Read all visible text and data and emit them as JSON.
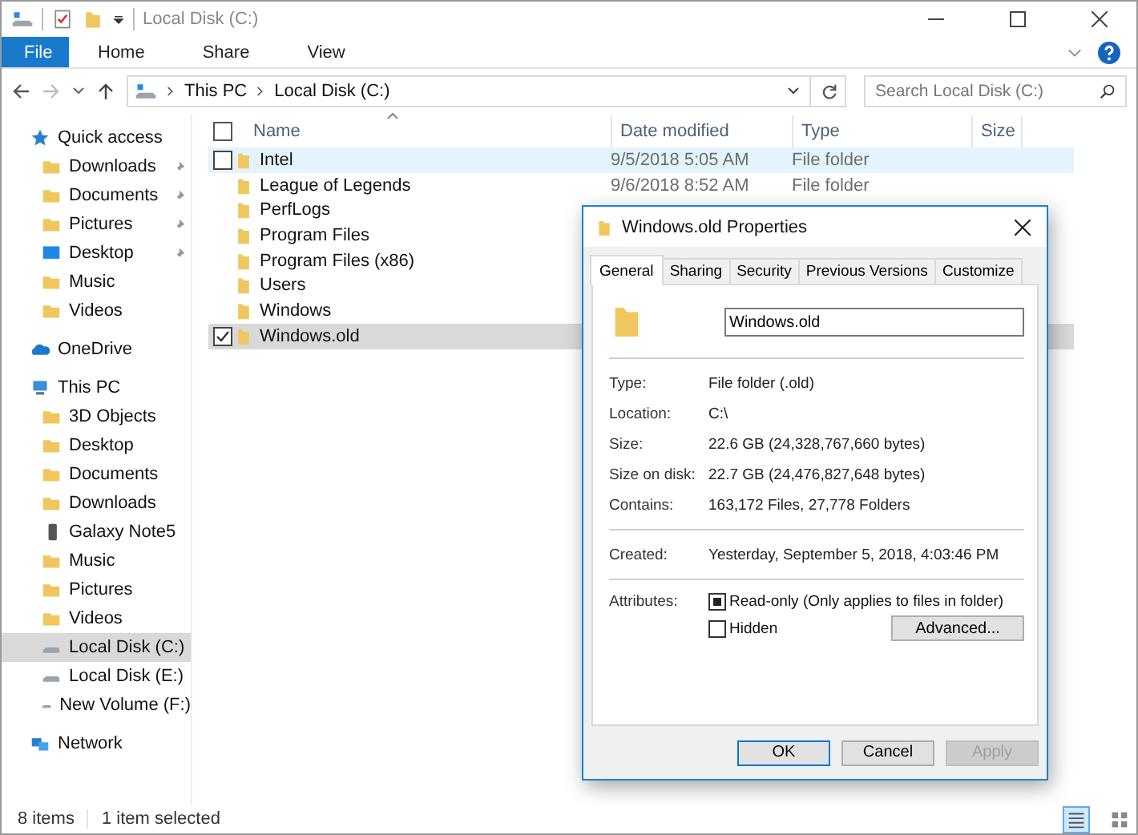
{
  "window": {
    "title": "Local Disk (C:)"
  },
  "ribbon_tabs": [
    {
      "label": "File",
      "selected": true
    },
    {
      "label": "Home",
      "selected": false
    },
    {
      "label": "Share",
      "selected": false
    },
    {
      "label": "View",
      "selected": false
    }
  ],
  "address": {
    "crumbs": [
      "This PC",
      "Local Disk (C:)"
    ]
  },
  "search": {
    "placeholder": "Search Local Disk (C:)"
  },
  "sidebar": {
    "items": [
      {
        "label": "Quick access",
        "kind": "star",
        "selected": false,
        "children": [
          {
            "label": "Downloads",
            "kind": "folder",
            "pinned": true,
            "selected": false
          },
          {
            "label": "Documents",
            "kind": "folder",
            "pinned": true,
            "selected": false
          },
          {
            "label": "Pictures",
            "kind": "folder",
            "pinned": true,
            "selected": false
          },
          {
            "label": "Desktop",
            "kind": "desktop",
            "pinned": true,
            "selected": false
          },
          {
            "label": "Music",
            "kind": "folder",
            "pinned": false,
            "selected": false
          },
          {
            "label": "Videos",
            "kind": "folder",
            "pinned": false,
            "selected": false
          }
        ]
      },
      {
        "label": "OneDrive",
        "kind": "cloud",
        "selected": false
      },
      {
        "label": "This PC",
        "kind": "pc",
        "selected": false,
        "children": [
          {
            "label": "3D Objects",
            "kind": "folder",
            "selected": false
          },
          {
            "label": "Desktop",
            "kind": "folder",
            "selected": false
          },
          {
            "label": "Documents",
            "kind": "folder",
            "selected": false
          },
          {
            "label": "Downloads",
            "kind": "folder",
            "selected": false
          },
          {
            "label": "Galaxy Note5",
            "kind": "phone",
            "selected": false
          },
          {
            "label": "Music",
            "kind": "folder",
            "selected": false
          },
          {
            "label": "Pictures",
            "kind": "folder",
            "selected": false
          },
          {
            "label": "Videos",
            "kind": "folder",
            "selected": false
          },
          {
            "label": "Local Disk (C:)",
            "kind": "drive",
            "selected": true
          },
          {
            "label": "Local Disk (E:)",
            "kind": "drive",
            "selected": false
          },
          {
            "label": "New Volume (F:)",
            "kind": "drive",
            "selected": false
          }
        ]
      },
      {
        "label": "Network",
        "kind": "network",
        "selected": false
      }
    ]
  },
  "table": {
    "columns": [
      "Name",
      "Date modified",
      "Type",
      "Size"
    ],
    "all_selected": false,
    "rows": [
      {
        "name": "Intel",
        "date": "9/5/2018 5:05 AM",
        "type": "File folder",
        "hovered": true,
        "selected": false
      },
      {
        "name": "League of Legends",
        "date": "9/6/2018 8:52 AM",
        "type": "File folder",
        "hovered": false,
        "selected": false
      },
      {
        "name": "PerfLogs",
        "hovered": false,
        "selected": false
      },
      {
        "name": "Program Files",
        "hovered": false,
        "selected": false
      },
      {
        "name": "Program Files (x86)",
        "hovered": false,
        "selected": false
      },
      {
        "name": "Users",
        "hovered": false,
        "selected": false
      },
      {
        "name": "Windows",
        "hovered": false,
        "selected": false
      },
      {
        "name": "Windows.old",
        "selected": true
      }
    ]
  },
  "status_bar": {
    "count": "8 items",
    "selection": "1 item selected",
    "views": [
      {
        "kind": "details",
        "selected": true
      },
      {
        "kind": "large",
        "selected": false
      }
    ]
  },
  "dialog": {
    "title": "Windows.old Properties",
    "tabs": [
      {
        "label": "General",
        "selected": true
      },
      {
        "label": "Sharing",
        "selected": false
      },
      {
        "label": "Security",
        "selected": false
      },
      {
        "label": "Previous Versions",
        "selected": false
      },
      {
        "label": "Customize",
        "selected": false
      }
    ],
    "name_value": "Windows.old",
    "groups": [
      [
        {
          "label": "Type:",
          "value": "File folder (.old)"
        },
        {
          "label": "Location:",
          "value": "C:\\"
        },
        {
          "label": "Size:",
          "value": "22.6 GB (24,328,767,660 bytes)"
        },
        {
          "label": "Size on disk:",
          "value": "22.7 GB (24,476,827,648 bytes)"
        },
        {
          "label": "Contains:",
          "value": "163,172 Files, 27,778 Folders"
        }
      ],
      [
        {
          "label": "Created:",
          "value": "Yesterday, September 5, 2018, 4:03:46 PM"
        }
      ]
    ],
    "attributes_label": "Attributes:",
    "attributes": [
      {
        "label": "Read-only (Only applies to files in folder)",
        "indeterminate": true
      },
      {
        "label": "Hidden",
        "checked": false
      }
    ],
    "advanced_button": "Advanced...",
    "buttons": [
      {
        "label": "OK",
        "default": true,
        "disabled": false
      },
      {
        "label": "Cancel",
        "default": false,
        "disabled": false
      },
      {
        "label": "Apply",
        "default": false,
        "disabled": true
      }
    ]
  }
}
